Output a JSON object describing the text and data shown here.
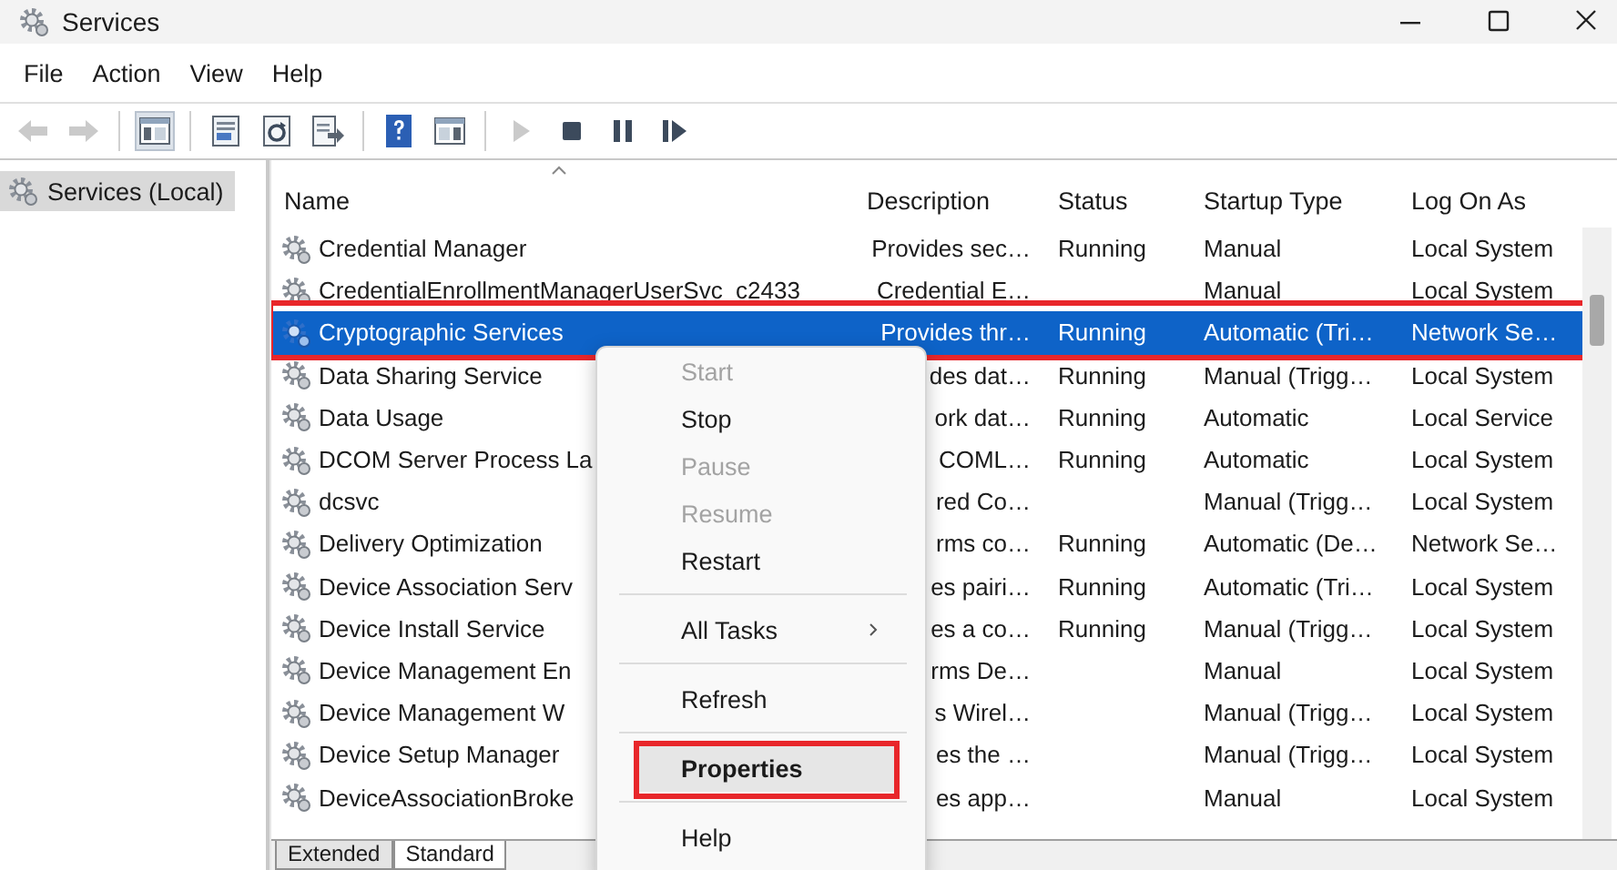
{
  "window": {
    "title": "Services"
  },
  "menu_bar": [
    "File",
    "Action",
    "View",
    "Help"
  ],
  "toolbar": [
    {
      "kind": "back",
      "disabled": true,
      "pressed": false
    },
    {
      "kind": "forward",
      "disabled": true,
      "pressed": false
    },
    {
      "kind": "separator"
    },
    {
      "kind": "console-tree",
      "disabled": false,
      "pressed": true
    },
    {
      "kind": "separator"
    },
    {
      "kind": "properties",
      "disabled": false,
      "pressed": false
    },
    {
      "kind": "refresh",
      "disabled": false,
      "pressed": false
    },
    {
      "kind": "export",
      "disabled": false,
      "pressed": false
    },
    {
      "kind": "separator"
    },
    {
      "kind": "help",
      "disabled": false,
      "pressed": false
    },
    {
      "kind": "action-pane",
      "disabled": false,
      "pressed": false
    },
    {
      "kind": "separator"
    },
    {
      "kind": "play",
      "disabled": true,
      "pressed": false
    },
    {
      "kind": "stop",
      "disabled": false,
      "pressed": false
    },
    {
      "kind": "pause",
      "disabled": false,
      "pressed": false
    },
    {
      "kind": "resume",
      "disabled": false,
      "pressed": false
    }
  ],
  "tree": {
    "items": [
      {
        "label": "Services (Local)",
        "selected": true
      }
    ]
  },
  "table": {
    "columns": [
      {
        "label": "Name",
        "sorted": true
      },
      {
        "label": "Description",
        "sorted": false
      },
      {
        "label": "Status",
        "sorted": false
      },
      {
        "label": "Startup Type",
        "sorted": false
      },
      {
        "label": "Log On As",
        "sorted": false
      }
    ],
    "rows": [
      {
        "name": "Credential Manager",
        "description": "Provides sec…",
        "status": "Running",
        "startup_type": "Manual",
        "log_on_as": "Local System",
        "selected": false,
        "highlighted": false
      },
      {
        "name": "CredentialEnrollmentManagerUserSvc_c2433",
        "description": "Credential E…",
        "startup_type": "Manual",
        "log_on_as": "Local System",
        "selected": false,
        "highlighted": false
      },
      {
        "name": "Cryptographic Services",
        "description": "Provides thr…",
        "status": "Running",
        "startup_type": "Automatic (Tri…",
        "log_on_as": "Network Se…",
        "selected": true,
        "highlighted": true
      },
      {
        "name": "Data Sharing Service",
        "description": "des dat…",
        "status": "Running",
        "startup_type": "Manual (Trigg…",
        "log_on_as": "Local System",
        "selected": false,
        "highlighted": false
      },
      {
        "name": "Data Usage",
        "description": "ork dat…",
        "status": "Running",
        "startup_type": "Automatic",
        "log_on_as": "Local Service",
        "selected": false,
        "highlighted": false
      },
      {
        "name": "DCOM Server Process La",
        "description": "COML…",
        "status": "Running",
        "startup_type": "Automatic",
        "log_on_as": "Local System",
        "selected": false,
        "highlighted": false
      },
      {
        "name": "dcsvc",
        "description": "red Co…",
        "startup_type": "Manual (Trigg…",
        "log_on_as": "Local System",
        "selected": false,
        "highlighted": false
      },
      {
        "name": "Delivery Optimization",
        "description": "rms co…",
        "status": "Running",
        "startup_type": "Automatic (De…",
        "log_on_as": "Network Se…",
        "selected": false,
        "highlighted": false
      },
      {
        "name": "Device Association Serv",
        "description": "es pairi…",
        "status": "Running",
        "startup_type": "Automatic (Tri…",
        "log_on_as": "Local System",
        "selected": false,
        "highlighted": false
      },
      {
        "name": "Device Install Service",
        "description": "es a co…",
        "status": "Running",
        "startup_type": "Manual (Trigg…",
        "log_on_as": "Local System",
        "selected": false,
        "highlighted": false
      },
      {
        "name": "Device Management En",
        "description": "rms De…",
        "startup_type": "Manual",
        "log_on_as": "Local System",
        "selected": false,
        "highlighted": false
      },
      {
        "name": "Device Management W",
        "description": "s Wirel…",
        "startup_type": "Manual (Trigg…",
        "log_on_as": "Local System",
        "selected": false,
        "highlighted": false
      },
      {
        "name": "Device Setup Manager",
        "description": "es the …",
        "startup_type": "Manual (Trigg…",
        "log_on_as": "Local System",
        "selected": false,
        "highlighted": false
      },
      {
        "name": "DeviceAssociationBroke",
        "description": "es app…",
        "startup_type": "Manual",
        "log_on_as": "Local System",
        "selected": false,
        "highlighted": false
      }
    ]
  },
  "context_menu": {
    "items": [
      {
        "kind": "item",
        "label": "Start",
        "disabled": true,
        "default": false,
        "submenu": false,
        "highlighted": false
      },
      {
        "kind": "item",
        "label": "Stop",
        "disabled": false,
        "default": false,
        "submenu": false,
        "highlighted": false
      },
      {
        "kind": "item",
        "label": "Pause",
        "disabled": true,
        "default": false,
        "submenu": false,
        "highlighted": false
      },
      {
        "kind": "item",
        "label": "Resume",
        "disabled": true,
        "default": false,
        "submenu": false,
        "highlighted": false
      },
      {
        "kind": "item",
        "label": "Restart",
        "disabled": false,
        "default": false,
        "submenu": false,
        "highlighted": false
      },
      {
        "kind": "separator"
      },
      {
        "kind": "item",
        "label": "All Tasks",
        "disabled": false,
        "default": false,
        "submenu": true,
        "highlighted": false
      },
      {
        "kind": "separator"
      },
      {
        "kind": "item",
        "label": "Refresh",
        "disabled": false,
        "default": false,
        "submenu": false,
        "highlighted": false
      },
      {
        "kind": "separator"
      },
      {
        "kind": "item",
        "label": "Properties",
        "disabled": false,
        "default": true,
        "submenu": false,
        "highlighted": true
      },
      {
        "kind": "separator"
      },
      {
        "kind": "item",
        "label": "Help",
        "disabled": false,
        "default": false,
        "submenu": false,
        "highlighted": false
      }
    ]
  },
  "bottom_tabs": [
    {
      "label": "Extended",
      "selected": false
    },
    {
      "label": "Standard",
      "selected": true
    }
  ]
}
